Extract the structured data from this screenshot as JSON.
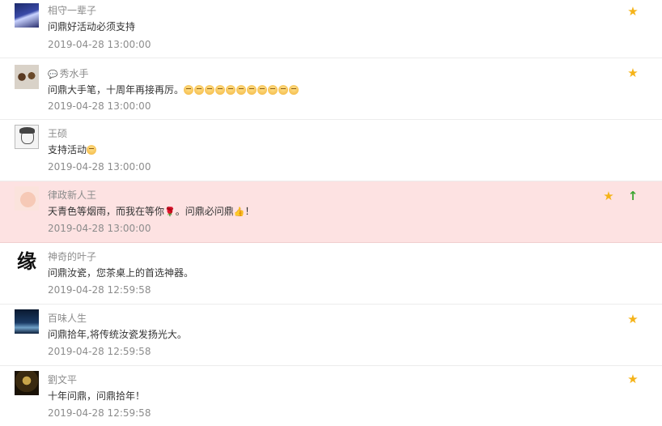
{
  "comments": [
    {
      "name": "相守一辈子",
      "text": "问鼎好活动必须支持",
      "time": "2019-04-28 13:00:00",
      "starred": true,
      "pinned": false,
      "highlighted": false,
      "avatar_icon": "avatar-purple-scene",
      "emoji_count": 0
    },
    {
      "name": "秀水手",
      "name_prefix_icon": "chat-bubble-icon",
      "text": "问鼎大手笔，十周年再接再厉。",
      "time": "2019-04-28 13:00:00",
      "starred": true,
      "pinned": false,
      "highlighted": false,
      "avatar_icon": "avatar-bracelet",
      "emoji_count": 11
    },
    {
      "name": "王硕",
      "text": "支持活动",
      "time": "2019-04-28 13:00:00",
      "starred": false,
      "pinned": false,
      "highlighted": false,
      "avatar_icon": "avatar-sketch",
      "emoji_count": 1
    },
    {
      "name": "律政新人王",
      "text_parts": [
        "天青色等烟雨，而我在等你",
        "。问鼎必问鼎",
        "！"
      ],
      "time": "2019-04-28 13:00:00",
      "starred": true,
      "pinned": true,
      "highlighted": true,
      "avatar_icon": "avatar-baby",
      "emoji_count": 0
    },
    {
      "name": "神奇的叶子",
      "text": "问鼎汝瓷，您茶桌上的首选神器。",
      "time": "2019-04-28 12:59:58",
      "starred": false,
      "pinned": false,
      "highlighted": false,
      "avatar_icon": "avatar-calligraphy",
      "avatar_text": "缘",
      "emoji_count": 0
    },
    {
      "name": "百味人生",
      "text": "问鼎拾年,将传统汝瓷发扬光大。",
      "time": "2019-04-28 12:59:58",
      "starred": true,
      "pinned": false,
      "highlighted": false,
      "avatar_icon": "avatar-night-scene",
      "emoji_count": 0
    },
    {
      "name": "劉文平",
      "text": "十年问鼎，问鼎拾年！",
      "time": "2019-04-28 12:59:58",
      "starred": true,
      "pinned": false,
      "highlighted": false,
      "avatar_icon": "avatar-dark-figure",
      "emoji_count": 0
    }
  ],
  "icons": {
    "star": "★",
    "pin": "↑",
    "rose": "🌹",
    "thumb": "👍",
    "bubble": "💬"
  },
  "colors": {
    "star": "#f5b318",
    "pin": "#3aa52f",
    "highlight_bg": "#fde2e2",
    "meta_text": "#8c8c8c",
    "body_text": "#333333"
  }
}
